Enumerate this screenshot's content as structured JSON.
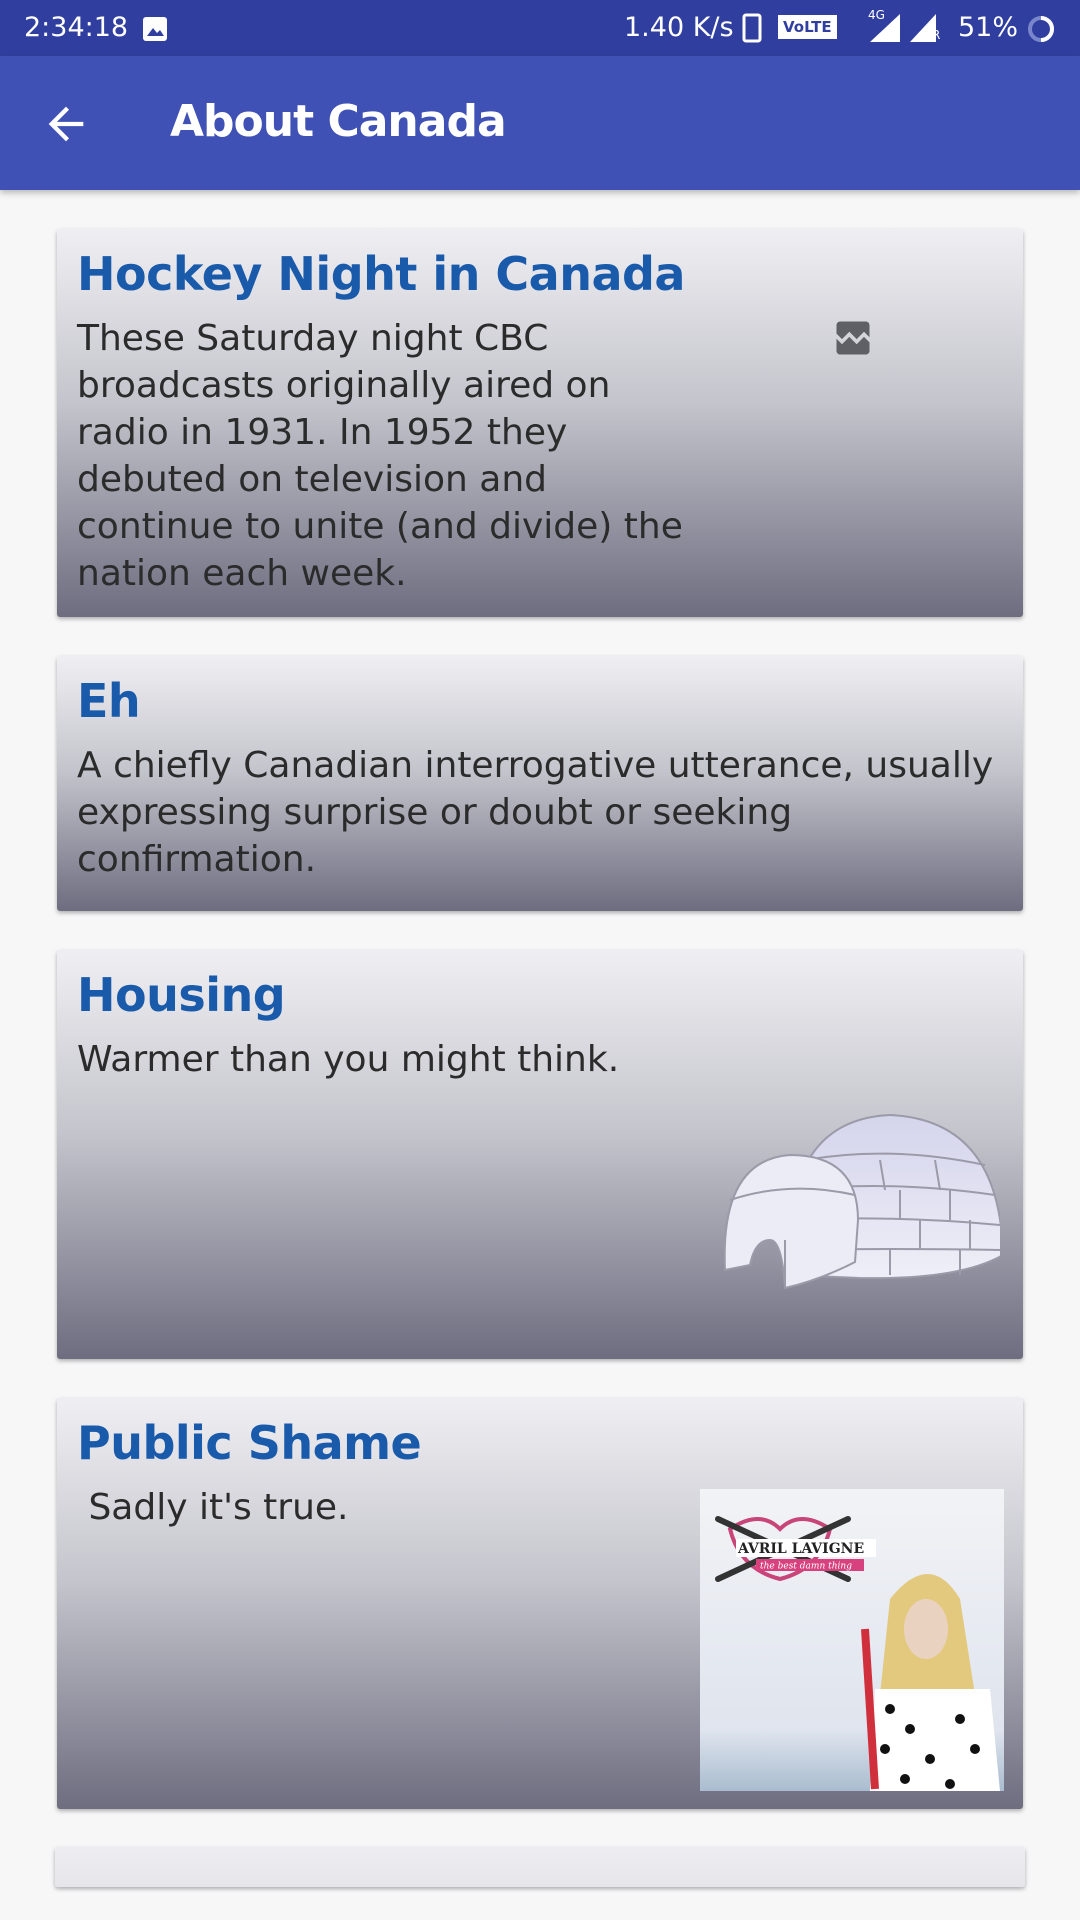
{
  "status_bar": {
    "time": "2:34:18",
    "net_speed": "1.40 K/s",
    "volte": "VoLTE",
    "network": "4G",
    "roaming": "R",
    "battery": "51%"
  },
  "app_bar": {
    "title": "About Canada",
    "back_icon": "arrow-left-icon"
  },
  "cards": [
    {
      "title": "Hockey Night in Canada",
      "body": "These Saturday night CBC broadcasts originally aired on radio in 1931. In 1952 they debuted on television and continue to unite (and divide) the nation each week.",
      "image": "broken-image-icon"
    },
    {
      "title": "Eh",
      "body": "A chiefly Canadian interrogative utterance, usually expressing surprise or doubt or seeking confirmation."
    },
    {
      "title": "Housing",
      "body": "Warmer than you might think.",
      "image": "igloo-image"
    },
    {
      "title": "Public Shame",
      "body": " Sadly it's true.",
      "image": "album-cover-image",
      "image_text": [
        "AVRIL LAVIGNE",
        "the best damn thing"
      ]
    }
  ]
}
